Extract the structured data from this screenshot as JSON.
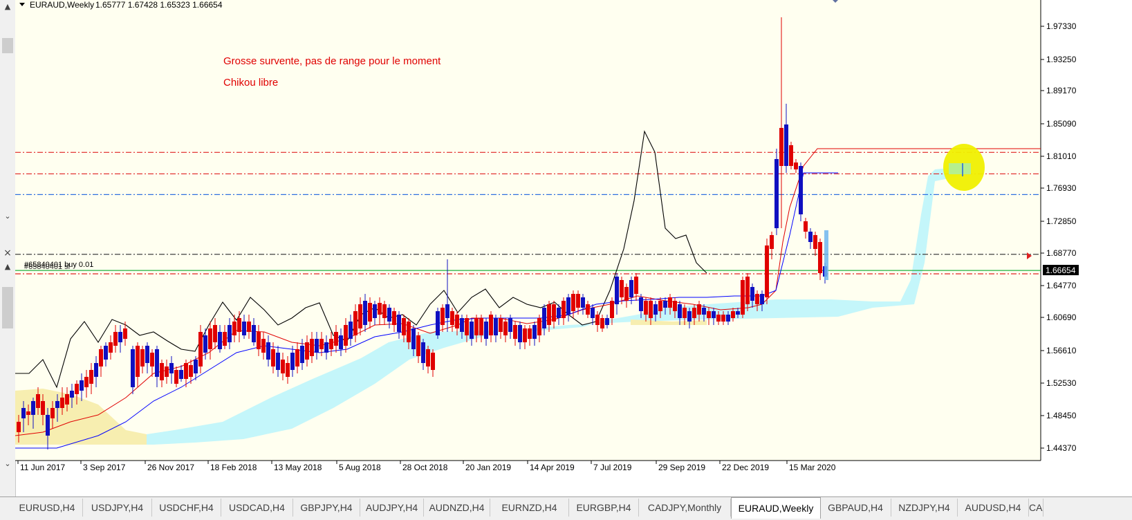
{
  "header": {
    "symbol": "EURAUD,Weekly",
    "ohlc": "1.65777 1.67428 1.65323 1.66654"
  },
  "annotations": {
    "line1": "Grosse survente, pas de range pour le moment",
    "line2": "Chikou libre",
    "order_label": "#65840401 buy 0.01",
    "order_label_overlap": "#65840401 sl"
  },
  "price_axis": {
    "ticks": [
      "1.97330",
      "1.93250",
      "1.89170",
      "1.85090",
      "1.81010",
      "1.76930",
      "1.72850",
      "1.68770",
      "1.64770",
      "1.60690",
      "1.56610",
      "1.52530",
      "1.48450",
      "1.44370"
    ],
    "current_price": "1.66654"
  },
  "time_axis": {
    "ticks": [
      "11 Jun 2017",
      "3 Sep 2017",
      "26 Nov 2017",
      "18 Feb 2018",
      "13 May 2018",
      "5 Aug 2018",
      "28 Oct 2018",
      "20 Jan 2019",
      "14 Apr 2019",
      "7 Jul 2019",
      "29 Sep 2019",
      "22 Dec 2019",
      "15 Mar 2020"
    ]
  },
  "tabs": [
    "EURUSD,H4",
    "USDJPY,H4",
    "USDCHF,H4",
    "USDCAD,H4",
    "GBPJPY,H4",
    "AUDJPY,H4",
    "AUDNZD,H4",
    "EURNZD,H4",
    "EURGBP,H4",
    "CADJPY,Monthly",
    "EURAUD,Weekly",
    "GBPAUD,H4",
    "NZDJPY,H4",
    "AUDUSD,H4",
    "CAI"
  ],
  "active_tab": "EURAUD,Weekly",
  "colors": {
    "background": "#fffff0",
    "bull": "#1010c0",
    "bear": "#e00000",
    "kumo_bull": "#c4f6fa",
    "kumo_bear": "#f7eeb0",
    "chikou": "#000000",
    "tenkan": "#e00000",
    "kijun": "#0000ff",
    "highlight": "#f0f000"
  },
  "chart_data": {
    "type": "candlestick",
    "ylim": [
      1.437,
      1.983
    ],
    "hlines": [
      {
        "price": 1.815,
        "color": "#e02020",
        "style": "dashdot"
      },
      {
        "price": 1.788,
        "color": "#e02020",
        "style": "dashdot"
      },
      {
        "price": 1.762,
        "color": "#3070e0",
        "style": "dashdot"
      },
      {
        "price": 1.687,
        "color": "#404040",
        "style": "dashdot"
      },
      {
        "price": 1.6667,
        "color": "#20b040",
        "style": "solid"
      },
      {
        "price": 1.6625,
        "color": "#e02020",
        "style": "dashdot"
      }
    ]
  }
}
